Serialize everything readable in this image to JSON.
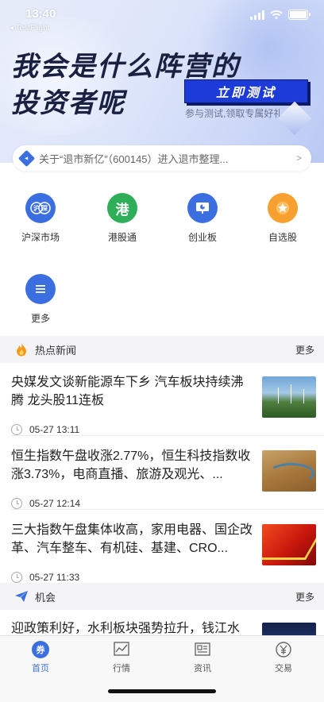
{
  "status_bar": {
    "time": "13:40",
    "back_label": "◂ TestFlight"
  },
  "banner": {
    "line1": "我会是什么阵营的",
    "line2": "投资者呢",
    "cta": "立即测试",
    "subtitle": "参与测试,领取专属好礼"
  },
  "notice": {
    "text": "关于“退市新亿”（600145）进入退市整理...",
    "arrow": ">"
  },
  "grid": [
    {
      "label": "沪深市场",
      "icon": "shanghai-shenzhen-icon",
      "glyph": "沪深"
    },
    {
      "label": "港股通",
      "icon": "hk-icon",
      "glyph": "港"
    },
    {
      "label": "创业板",
      "icon": "growth-board-icon",
      "glyph": ""
    },
    {
      "label": "自选股",
      "icon": "star-icon",
      "glyph": "★"
    },
    {
      "label": "更多",
      "icon": "menu-icon",
      "glyph": "≡"
    }
  ],
  "hot_news": {
    "title": "热点新闻",
    "more": "更多",
    "items": [
      {
        "title": "央媒发文谈新能源车下乡 汽车板块持续沸腾 龙头股11连板",
        "time": "05-27 13:11"
      },
      {
        "title": "恒生指数午盘收涨2.77%，恒生科技指数收涨3.73%，电商直播、旅游及观光、...",
        "time": "05-27 12:14"
      },
      {
        "title": "三大指数午盘集体收高，家用电器、国企改革、汽车整车、有机硅、基建、CRO...",
        "time": "05-27 11:33"
      }
    ]
  },
  "opportunity": {
    "title": "机会",
    "more": "更多",
    "items": [
      {
        "title": "迎政策利好，水利板块强势拉升，钱江水"
      }
    ]
  },
  "tabbar": [
    {
      "label": "首页",
      "icon": "home-icon",
      "active": true
    },
    {
      "label": "行情",
      "icon": "market-chart-icon",
      "active": false
    },
    {
      "label": "资讯",
      "icon": "news-icon",
      "active": false
    },
    {
      "label": "交易",
      "icon": "trade-yuan-icon",
      "active": false
    }
  ],
  "colors": {
    "accent": "#3b6fe0",
    "cta": "#1d3bd8",
    "green": "#2fae5a",
    "orange": "#f7a030"
  }
}
